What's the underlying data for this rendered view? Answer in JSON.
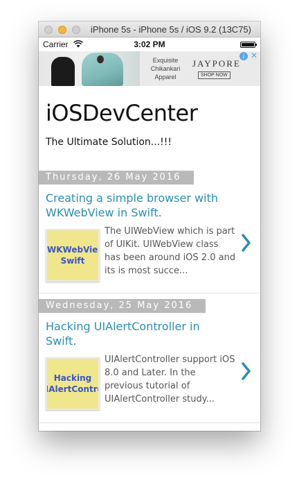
{
  "window": {
    "title": "iPhone 5s - iPhone 5s / iOS 9.2 (13C75)"
  },
  "status_bar": {
    "carrier": "Carrier",
    "time": "3:02 PM",
    "wifi_icon": "wifi-icon",
    "battery_icon": "battery-icon"
  },
  "ad": {
    "tagline_line1": "Exquisite",
    "tagline_line2": "Chikankari",
    "tagline_line3": "Apparel",
    "brand": "JAYPORE",
    "cta": "SHOP NOW",
    "info_icon_glyph": "i",
    "close_icon_glyph": "✕"
  },
  "blog": {
    "title": "iOSDevCenter",
    "subtitle": "The Ultimate Solution...!!!"
  },
  "posts": [
    {
      "date": "Thursday, 26 May 2016",
      "title": "Creating a simple browser with WKWebView in Swift.",
      "thumb_line1": "WKWebView",
      "thumb_line2": "Swift",
      "snippet": "The UIWebView which is part of UIKit. UIWebView class has been around iOS 2.0 and its is most succe..."
    },
    {
      "date": "Wednesday, 25 May 2016",
      "title": "Hacking UIAlertController in Swift.",
      "thumb_line1": "Hacking",
      "thumb_line2": "UIAlertController",
      "snippet": "UIAlertController support iOS 8.0 and Later. In the previous tutorial of  UIAlertController  study..."
    }
  ],
  "colors": {
    "link": "#2a8eb3",
    "date_header_bg": "#b9b9b9",
    "thumb_bg": "#f0e68c",
    "thumb_text": "#3a55c4"
  }
}
